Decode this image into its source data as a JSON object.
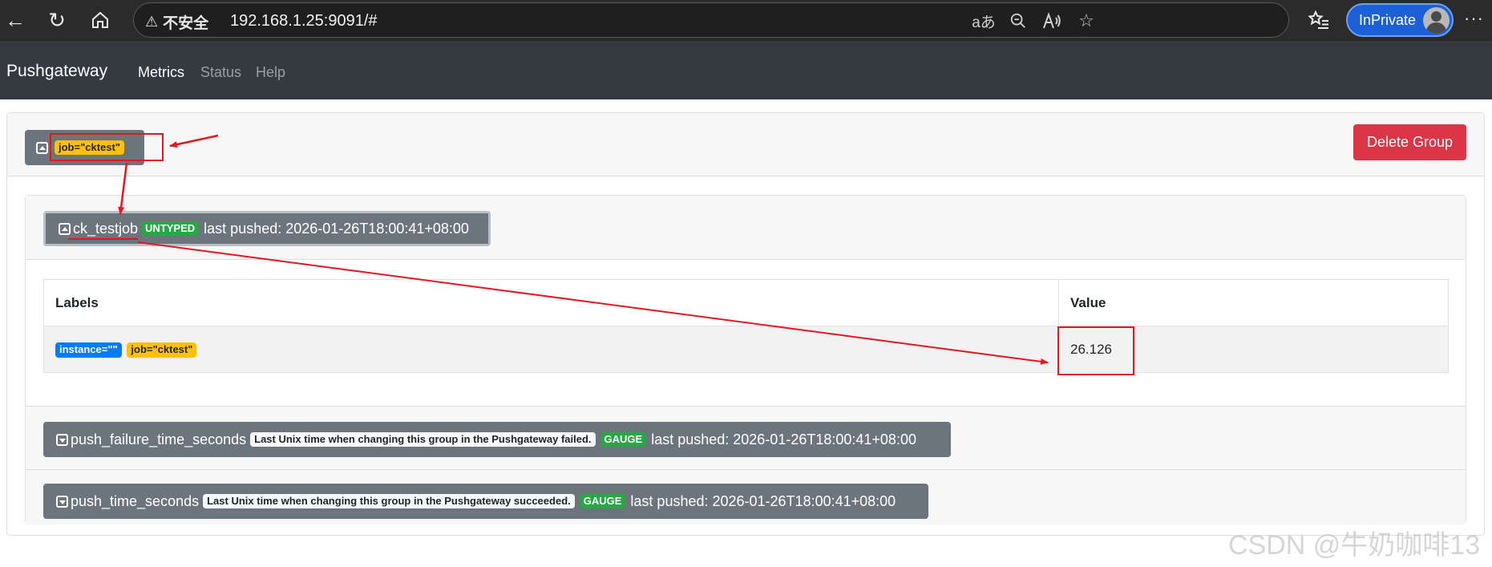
{
  "browser": {
    "security_label": "不安全",
    "url": "192.168.1.25:9091/#",
    "inprivate_label": "InPrivate",
    "read_aloud_icon": "aあ",
    "more_icon": "···"
  },
  "navbar": {
    "brand": "Pushgateway",
    "links": [
      "Metrics",
      "Status",
      "Help"
    ],
    "active": "Metrics"
  },
  "group": {
    "label_badge": "job=\"cktest\"",
    "delete_label": "Delete Group"
  },
  "metrics": [
    {
      "name": "ck_testjob",
      "help": "",
      "type": "UNTYPED",
      "last_pushed": "last pushed: 2026-01-26T18:00:41+08:00",
      "expanded": true,
      "table": {
        "headers": [
          "Labels",
          "Value"
        ],
        "rows": [
          {
            "labels": [
              "instance=\"\"",
              "job=\"cktest\""
            ],
            "value": "26.126"
          }
        ]
      }
    },
    {
      "name": "push_failure_time_seconds",
      "help": "Last Unix time when changing this group in the Pushgateway failed.",
      "type": "GAUGE",
      "last_pushed": "last pushed: 2026-01-26T18:00:41+08:00",
      "expanded": false
    },
    {
      "name": "push_time_seconds",
      "help": "Last Unix time when changing this group in the Pushgateway succeeded.",
      "type": "GAUGE",
      "last_pushed": "last pushed: 2026-01-26T18:00:41+08:00",
      "expanded": false
    }
  ],
  "watermark": "CSDN @牛奶咖啡13",
  "colors": {
    "annotation_red": "#e3171d",
    "danger": "#dc3545",
    "warning": "#ffc107",
    "primary": "#007bff",
    "success": "#28a745",
    "navbar_bg": "#343a40"
  }
}
